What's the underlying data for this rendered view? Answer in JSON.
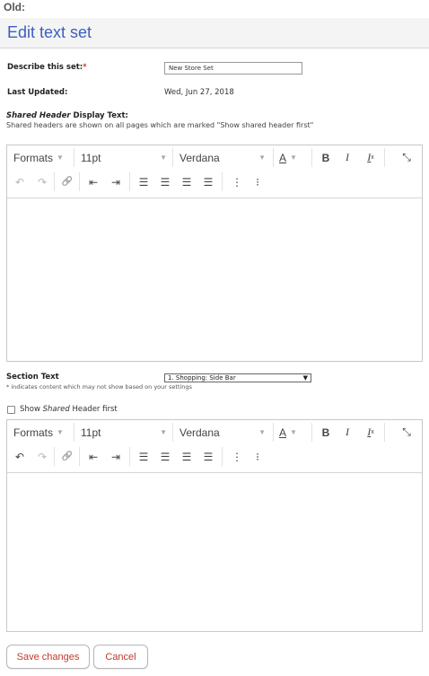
{
  "top_label": "Old:",
  "title": "Edit text set",
  "describe": {
    "label": "Describe this set:",
    "required_mark": "*",
    "value": "New Store Set"
  },
  "last_updated": {
    "label": "Last Updated:",
    "value": "Wed, Jun 27, 2018"
  },
  "shared_header": {
    "title_italic": "Shared Header",
    "title_rest": " Display Text:",
    "help": "Shared headers are shown on all pages which are marked \"Show shared header first\""
  },
  "toolbar": {
    "formats": "Formats",
    "font_size": "11pt",
    "font_family": "Verdana",
    "text_color_letter": "A",
    "bold": "B",
    "italic": "I",
    "clear_format": "I",
    "clear_sub": "x",
    "fullscreen": "⤡",
    "undo": "↶",
    "redo": "↷",
    "link": "🔗",
    "outdent": "⇤",
    "indent": "⇥",
    "align_left": "☰",
    "align_center": "☰",
    "align_right": "☰",
    "justify": "☰",
    "numbered_list": "⋮",
    "bullet_list": "⁝"
  },
  "section": {
    "label": "Section Text",
    "note": "* indicates content which may not show based on your settings",
    "selected": "1. Shopping: Side Bar",
    "arrow": "▼"
  },
  "show_shared": {
    "prefix": "Show ",
    "italic": "Shared",
    "suffix": " Header first",
    "checked": false
  },
  "buttons": {
    "save": "Save changes",
    "cancel": "Cancel"
  },
  "colors": {
    "title": "#3b5fc0",
    "button_text": "#c0392b",
    "required": "#c0392b"
  }
}
